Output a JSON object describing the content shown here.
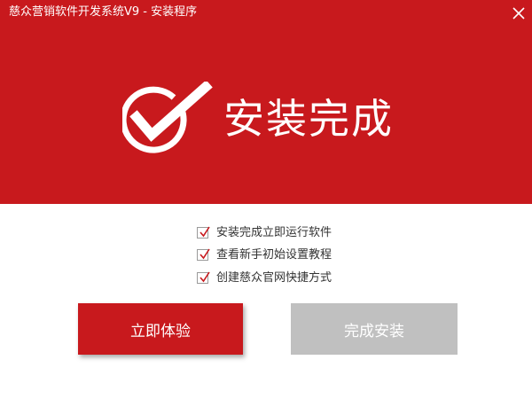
{
  "window": {
    "title": "慈众营销软件开发系统V9 - 安装程序",
    "close_icon": "close-icon"
  },
  "hero": {
    "icon": "check-circle-icon",
    "title": "安装完成"
  },
  "options": [
    {
      "label": "安装完成立即运行软件",
      "checked": true
    },
    {
      "label": "查看新手初始设置教程",
      "checked": true
    },
    {
      "label": "创建慈众官网快捷方式",
      "checked": true
    }
  ],
  "buttons": {
    "primary_label": "立即体验",
    "secondary_label": "完成安装"
  },
  "colors": {
    "brand": "#c8191d",
    "disabled": "#c0c0c0"
  }
}
